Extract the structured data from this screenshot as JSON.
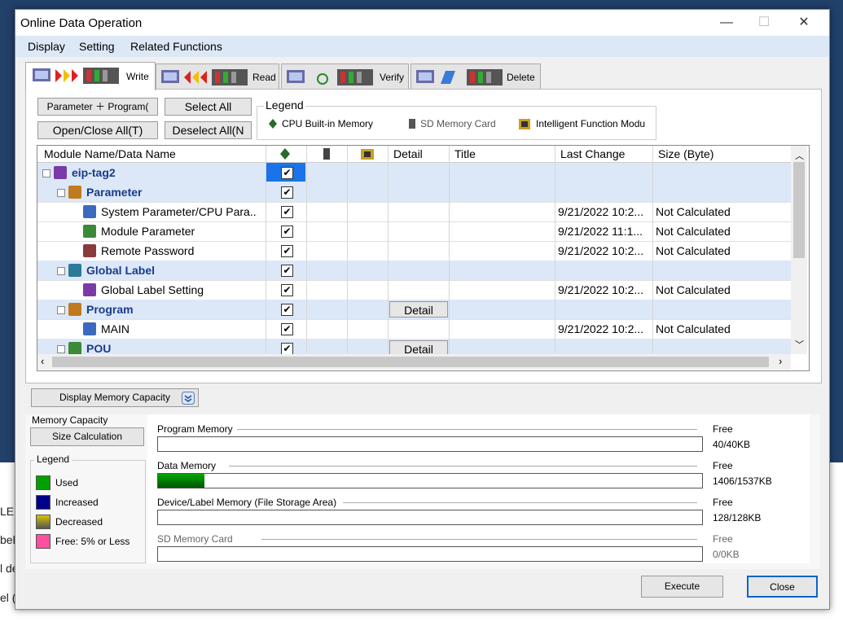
{
  "window": {
    "title": "Online Data Operation",
    "minimize": "—",
    "maximize": "☐",
    "close": "✕"
  },
  "menu": [
    "Display",
    "Setting",
    "Related Functions"
  ],
  "tabs": [
    {
      "label": "Write",
      "icon": "write-icon"
    },
    {
      "label": "Read",
      "icon": "read-icon"
    },
    {
      "label": "Verify",
      "icon": "verify-icon"
    },
    {
      "label": "Delete",
      "icon": "delete-icon"
    }
  ],
  "buttons": {
    "param_program": "Parameter ＋ Program(",
    "select_all": "Select All",
    "open_close_all": "Open/Close All(T)",
    "deselect_all": "Deselect  All(N",
    "display_memory": "Display Memory Capacity",
    "size_calc": "Size Calculation",
    "execute": "Execute",
    "close": "Close"
  },
  "legend": {
    "caption": "Legend",
    "items": [
      "CPU Built-in Memory",
      "SD Memory Card",
      "Intelligent Function Modu"
    ]
  },
  "grid": {
    "headers": [
      "Module Name/Data Name",
      "",
      "",
      "",
      "Detail",
      "Title",
      "Last Change",
      "Size (Byte)"
    ],
    "rows": [
      {
        "name": "eip-tag2",
        "cat": true,
        "indent": 0,
        "checked": true,
        "detail": "",
        "change": "",
        "size": "",
        "selected": true
      },
      {
        "name": "Parameter",
        "cat": true,
        "indent": 1,
        "checked": true,
        "detail": "",
        "change": "",
        "size": ""
      },
      {
        "name": "System Parameter/CPU Para...",
        "cat": false,
        "indent": 2,
        "checked": true,
        "detail": "",
        "change": "9/21/2022 10:2...",
        "size": "Not Calculated"
      },
      {
        "name": "Module Parameter",
        "cat": false,
        "indent": 2,
        "checked": true,
        "detail": "",
        "change": "9/21/2022 11:1...",
        "size": "Not Calculated"
      },
      {
        "name": "Remote Password",
        "cat": false,
        "indent": 2,
        "checked": true,
        "detail": "",
        "change": "9/21/2022 10:2...",
        "size": "Not Calculated"
      },
      {
        "name": "Global Label",
        "cat": true,
        "indent": 1,
        "checked": true,
        "detail": "",
        "change": "",
        "size": ""
      },
      {
        "name": "Global Label Setting",
        "cat": false,
        "indent": 2,
        "checked": true,
        "detail": "",
        "change": "9/21/2022 10:2...",
        "size": "Not Calculated"
      },
      {
        "name": "Program",
        "cat": true,
        "indent": 1,
        "checked": true,
        "detail": "Detail",
        "change": "",
        "size": ""
      },
      {
        "name": "MAIN",
        "cat": false,
        "indent": 2,
        "checked": true,
        "detail": "",
        "change": "9/21/2022 10:2...",
        "size": "Not Calculated"
      },
      {
        "name": "POU",
        "cat": true,
        "indent": 1,
        "checked": true,
        "detail": "Detail",
        "change": "",
        "size": ""
      }
    ]
  },
  "memory": {
    "caption": "Memory Capacity",
    "legend_caption": "Legend",
    "legend": [
      {
        "label": "Used",
        "color": "#00a000"
      },
      {
        "label": "Increased",
        "color": "#00008b"
      },
      {
        "label": "Decreased",
        "color": "#b8a000"
      },
      {
        "label": "Free: 5% or Less",
        "color": "#ff4fa0"
      }
    ],
    "free_label": "Free",
    "rows": [
      {
        "label": "Program Memory",
        "free": "40/40KB",
        "used_fraction": 0
      },
      {
        "label": "Data Memory",
        "free": "1406/1537KB",
        "used_fraction": 0.085
      },
      {
        "label": "Device/Label Memory (File Storage Area)",
        "free": "128/128KB",
        "used_fraction": 0
      },
      {
        "label": "SD Memory Card",
        "free": "0/0KB",
        "used_fraction": 0
      }
    ]
  },
  "background_fragments": [
    "LEI",
    "bel.",
    "l de",
    "el ("
  ]
}
